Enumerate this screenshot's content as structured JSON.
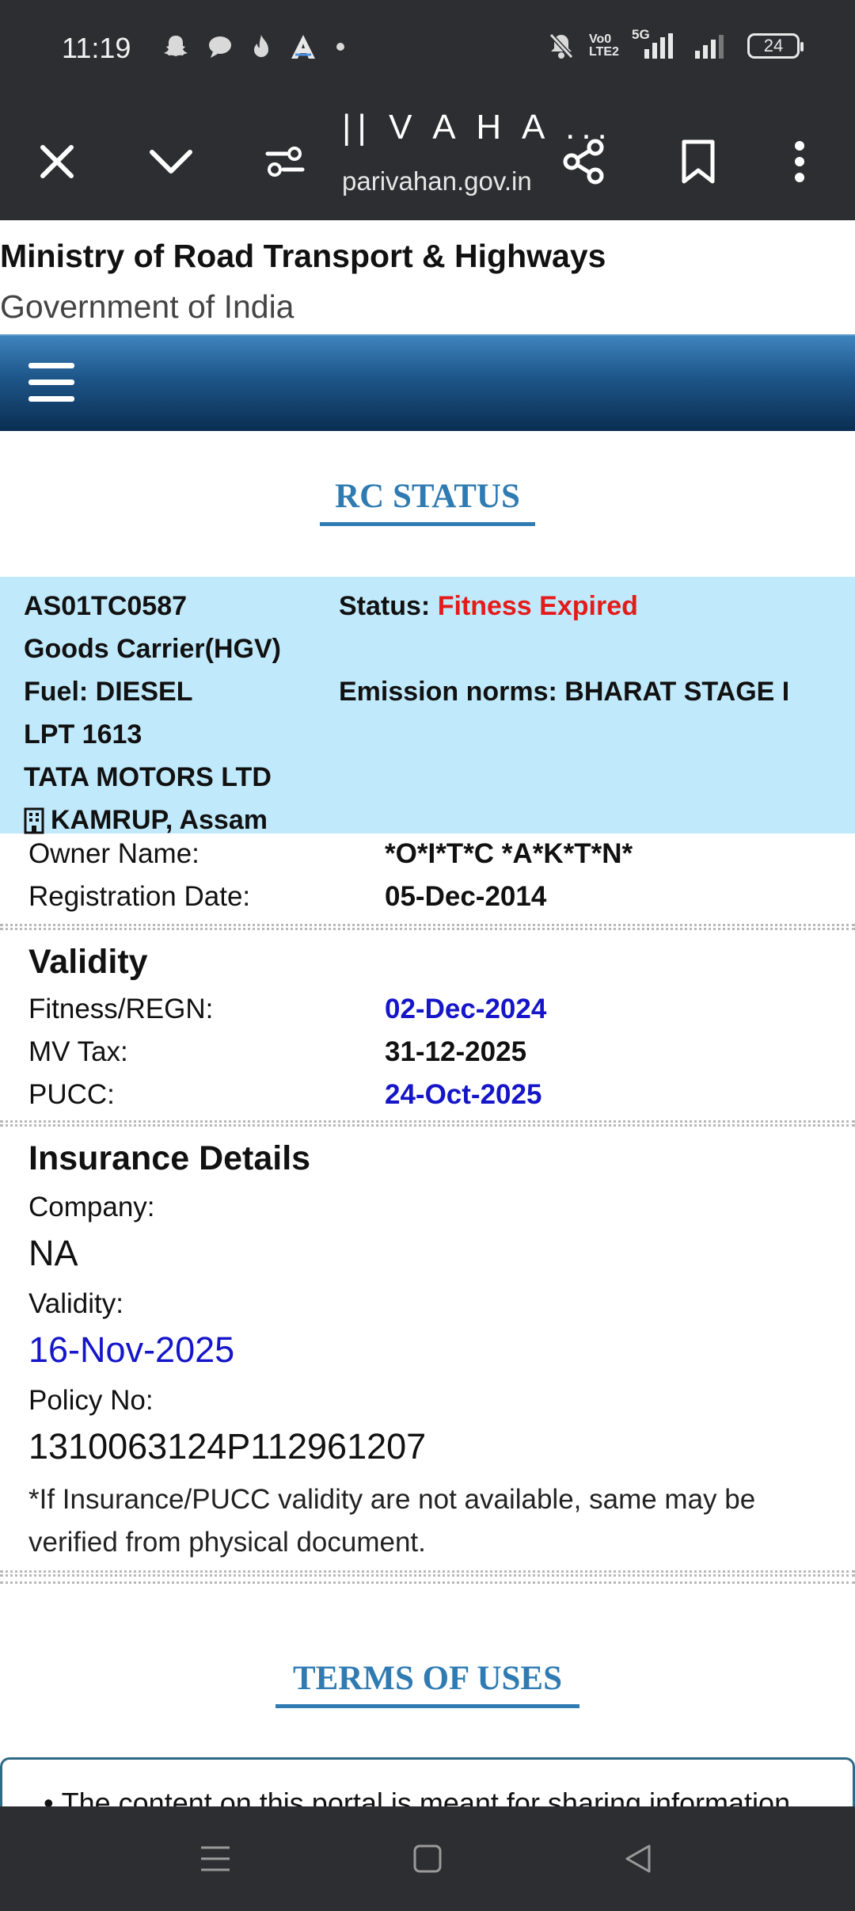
{
  "status_bar": {
    "time": "11:19",
    "battery": "24",
    "volte_label": "Vo0 LTE2",
    "network_label": "5G",
    "icons": [
      "snapchat-icon",
      "chat-icon",
      "flame-icon",
      "a-icon",
      "dot-icon",
      "mute-bell-icon",
      "signal-icon",
      "signal-icon",
      "battery-icon"
    ]
  },
  "browser": {
    "title": "|| V A H A ...",
    "domain": "parivahan.gov.in",
    "icons": [
      "close-icon",
      "chevron-down-icon",
      "page-settings-icon",
      "share-icon",
      "bookmark-icon",
      "more-vertical-icon"
    ]
  },
  "header": {
    "title": "Ministry of Road Transport & Highways",
    "subtitle": "Government of India"
  },
  "rc_status": {
    "heading": "RC STATUS",
    "reg_no": "AS01TC0587",
    "status_label": "Status:",
    "status_value": "Fitness Expired",
    "vehicle_class": "Goods Carrier(HGV)",
    "fuel": "Fuel: DIESEL",
    "emission": "Emission norms: BHARAT STAGE I",
    "model": "LPT 1613",
    "maker": "TATA MOTORS LTD",
    "rto": "KAMRUP, Assam",
    "colors": {
      "box_bg": "#c0e9fb",
      "status_red": "#e51b1b"
    }
  },
  "owner": {
    "owner_label": "Owner Name:",
    "owner_value": "*O*I*T*C *A*K*T*N*",
    "reg_date_label": "Registration Date:",
    "reg_date_value": "05-Dec-2014"
  },
  "validity": {
    "heading": "Validity",
    "fitness_label": "Fitness/REGN:",
    "fitness_value": "02-Dec-2024",
    "tax_label": "MV Tax:",
    "tax_value": "31-12-2025",
    "pucc_label": "PUCC:",
    "pucc_value": "24-Oct-2025"
  },
  "insurance": {
    "heading": "Insurance Details",
    "company_label": "Company:",
    "company_value": "NA",
    "validity_label": "Validity:",
    "validity_value": "16-Nov-2025",
    "policy_label": "Policy No:",
    "policy_value": "1310063124P112961207",
    "note": "*If Insurance/PUCC validity are not available, same may be verified from physical document."
  },
  "terms": {
    "heading": "TERMS OF USES",
    "first_item": "The content on this portal is meant for sharing information"
  },
  "nav_bar": {
    "icons": [
      "menu-icon",
      "home-square-icon",
      "back-triangle-icon"
    ]
  }
}
